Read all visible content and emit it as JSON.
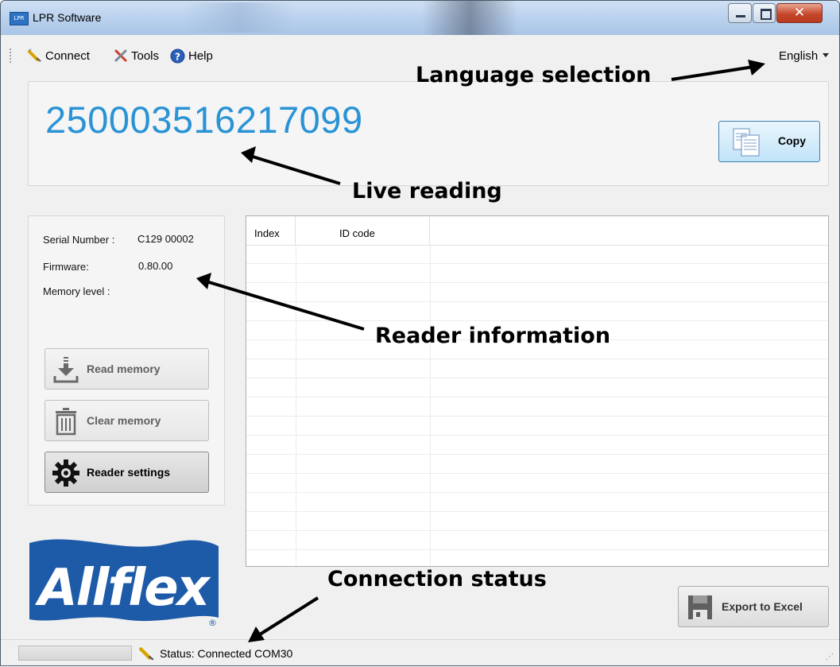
{
  "window": {
    "title": "LPR Software",
    "app_icon_text": "LPR"
  },
  "toolbar": {
    "connect": "Connect",
    "tools": "Tools",
    "help": "Help",
    "language": "English"
  },
  "live": {
    "reading": "250003516217099",
    "copy_label": "Copy"
  },
  "reader_info": {
    "serial_label": "Serial Number :",
    "serial_value": "C129 00002",
    "firmware_label": "Firmware:",
    "firmware_value": "0.80.00",
    "memory_label": "Memory level :"
  },
  "buttons": {
    "read_memory": "Read memory",
    "clear_memory": "Clear memory",
    "reader_settings": "Reader settings",
    "export": "Export to Excel"
  },
  "table": {
    "columns": [
      "Index",
      "ID code"
    ],
    "rows": []
  },
  "logo": {
    "text": "Allflex",
    "registered": "®"
  },
  "status": {
    "text": "Status: Connected COM30"
  },
  "annotations": {
    "language": "Language selection",
    "live": "Live reading",
    "reader": "Reader information",
    "connection": "Connection status"
  },
  "icons": [
    "connect-icon",
    "tools-icon",
    "help-icon",
    "dropdown-arrow-icon",
    "copy-icon",
    "download-icon",
    "trash-icon",
    "gear-icon",
    "excel-icon",
    "status-connect-icon"
  ],
  "colors": {
    "live_reading": "#2a93d5",
    "logo_blue": "#1d5ba8",
    "copy_border": "#3c7fb1"
  }
}
